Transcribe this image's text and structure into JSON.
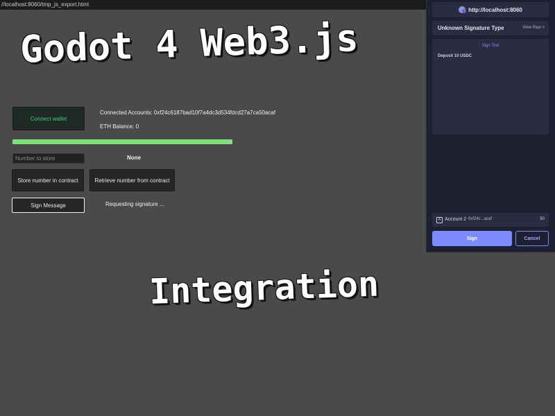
{
  "browser": {
    "url": "//localhost:8060/tmp_js_export.html"
  },
  "captions": {
    "line1": "Godot 4 Web3.js",
    "line2": "Integration"
  },
  "app": {
    "connect_button": "Connect wallet",
    "connected_accounts": "Connected Accounts: 0xf24c6187bad10f7a4dc3d534fdcd27a7ca50acaf",
    "eth_balance": "ETH Balance: 0",
    "progress": 1.0,
    "number_input_placeholder": "Number to store",
    "stored_value": "None",
    "store_button": "Store number in contract",
    "retrieve_button": "Retrieve number from contract",
    "sign_button": "Sign Message",
    "status_text": "Requesting signature ..."
  },
  "wallet": {
    "origin": "http://localhost:8060",
    "signature_type": "Unknown Signature Type",
    "view_raw": "View Raw >",
    "sign_text_title": "Sign Text",
    "message": "Deposit 10 USDC",
    "account_name": "Account 2",
    "account_address": "0xf24c...acaf",
    "account_balance": "$0",
    "sign_button": "Sign",
    "cancel_button": "Cancel"
  },
  "colors": {
    "background": "#4a4a4a",
    "progress_fill": "#7fe07a",
    "wallet_accent": "#7c8cff",
    "connect_text": "#3fcf7a"
  }
}
